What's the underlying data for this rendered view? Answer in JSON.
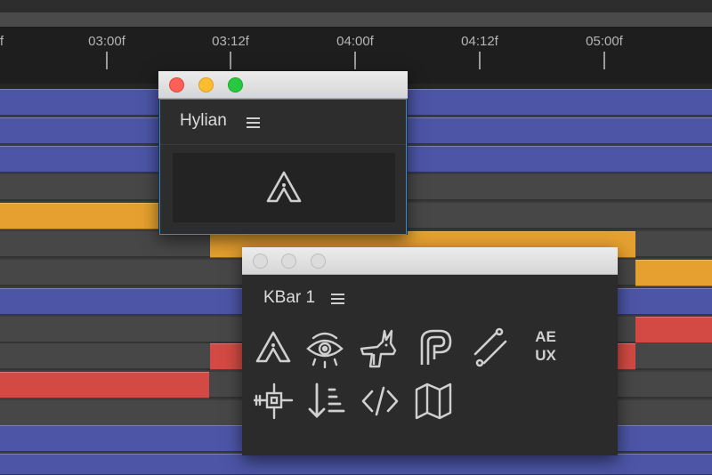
{
  "timeline": {
    "ticks": [
      {
        "label": "f"
      },
      {
        "label": "03:00f"
      },
      {
        "label": "03:12f"
      },
      {
        "label": "04:00f"
      },
      {
        "label": "04:12f"
      },
      {
        "label": "05:00f"
      }
    ]
  },
  "hylian_panel": {
    "title": "Hylian",
    "menu_icon": "hamburger-icon",
    "button_icon": "hylian-triforce-icon"
  },
  "kbar_panel": {
    "title": "KBar 1",
    "menu_icon": "hamburger-icon",
    "buttons_row1": [
      "hylian-icon",
      "eye-icon",
      "anubis-icon",
      "monogram-p-icon",
      "diagonal-lines-icon",
      "ae-ux-button"
    ],
    "buttons_row2": [
      "anchor-crosshair-icon",
      "sort-descending-icon",
      "code-brackets-icon",
      "map-icon"
    ],
    "ae_ux_line1": "AE",
    "ae_ux_line2": "UX"
  },
  "colors": {
    "track_blue": "#4c55a6",
    "track_orange": "#e5a02f",
    "track_red": "#d24a43",
    "close": "#fe5f57",
    "minimize": "#febc2e",
    "zoom": "#28c840"
  }
}
